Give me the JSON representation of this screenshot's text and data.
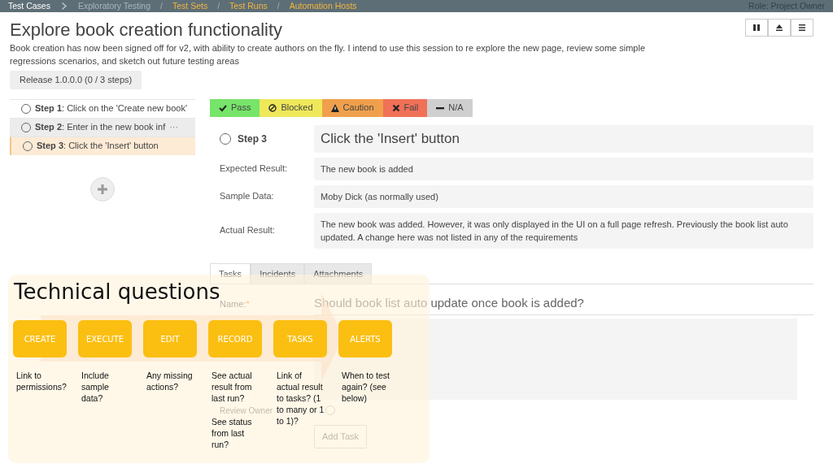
{
  "breadcrumb": [
    {
      "kind": "current",
      "label": "Test Cases"
    },
    {
      "kind": "chevron"
    },
    {
      "kind": "muted",
      "label": "Exploratory Testing"
    },
    {
      "kind": "slash",
      "text": "/"
    },
    {
      "kind": "link",
      "label": "Test Sets"
    },
    {
      "kind": "slash",
      "text": "/"
    },
    {
      "kind": "link",
      "label": "Test Runs"
    },
    {
      "kind": "slash",
      "text": "/"
    },
    {
      "kind": "link",
      "label": "Automation Hosts"
    }
  ],
  "role": "Role: Project Owner",
  "title": "Explore book creation functionality",
  "description": "Book creation has now been signed off for v2, with ability to create authors on the fly. I intend to use this session to re explore the new page, review some simple regressions scenarios, and sketch out future testing areas",
  "release": {
    "label": "Release 1.0.0.0",
    "count": "(0 / 3 steps)"
  },
  "steps": [
    {
      "text": "**Step 1**: Click on the 'Create new book'",
      "checked": false,
      "hovered": false,
      "selected": false
    },
    {
      "text": "**Step 2**: Enter in the new book inf",
      "more": "···",
      "checked": false,
      "hovered": true,
      "selected": false
    },
    {
      "text": "**Step 3**: Click the 'Insert' button",
      "checked": false,
      "hovered": false,
      "selected": true
    }
  ],
  "statuses": [
    {
      "kind": "pass",
      "label": "Pass",
      "color": "#77e46a"
    },
    {
      "kind": "blocked",
      "label": "Blocked",
      "color": "#efe85a"
    },
    {
      "kind": "caution",
      "label": "Caution",
      "color": "#f0a04c"
    },
    {
      "kind": "fail",
      "label": "Fail",
      "color": "#f07058"
    },
    {
      "kind": "na",
      "label": "N/A",
      "color": "#cfcfcf"
    }
  ],
  "step": {
    "label": "Step 3",
    "checked": false,
    "description": "Click the 'Insert' button",
    "fields": [
      {
        "label": "Expected Result:",
        "value": "The new book is added"
      },
      {
        "label": "Sample Data:",
        "value": "Moby Dick (as normally used)"
      },
      {
        "label": "Actual Result:",
        "value": "The new book was added. However, it was only displayed in the UI on a full page refresh. Previously the book list auto updated. A change here was not listed in any of the requirements"
      }
    ]
  },
  "tabs": [
    {
      "label": "Tasks",
      "selected": true
    },
    {
      "label": "Incidents",
      "selected": false
    },
    {
      "label": "Attachments",
      "selected": false
    }
  ],
  "task": {
    "name_label": "Name:",
    "required": "*",
    "name_value": "Should book list auto update once book is added?",
    "review_label": "Review Owner",
    "review_checked": false,
    "add_button": "Add Task"
  },
  "overlay": {
    "title": "Technical questions",
    "columns": [
      {
        "label": "CREATE",
        "notes": [
          "Link to permissions?"
        ]
      },
      {
        "label": "EXECUTE",
        "notes": [
          "Include sample data?"
        ]
      },
      {
        "label": "EDIT",
        "notes": [
          "Any missing actions?"
        ]
      },
      {
        "label": "RECORD",
        "notes": [
          "See actual result from last run?",
          "See status from last run?"
        ]
      },
      {
        "label": "TASKS",
        "notes": [
          "Link of actual result to tasks? (1 to many or 1 to 1)?"
        ]
      },
      {
        "label": "ALERTS",
        "notes": [
          "When to test again? (see below)"
        ]
      }
    ]
  }
}
